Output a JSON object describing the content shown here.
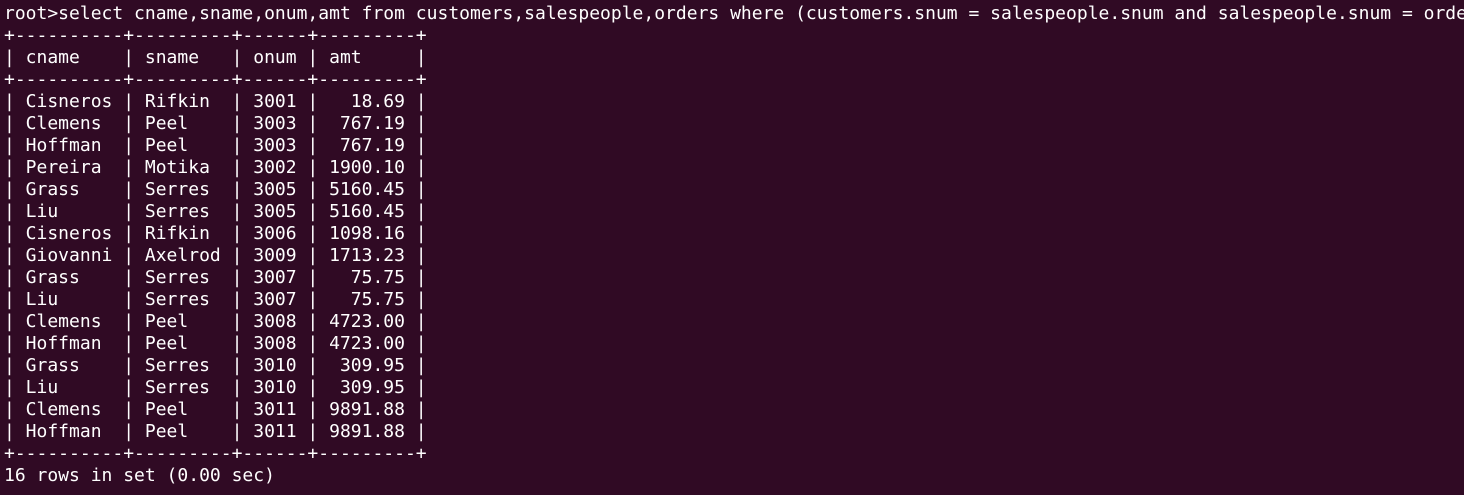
{
  "terminal": {
    "command_line": "root>select cname,sname,onum,amt from customers,salespeople,orders where (customers.snum = salespeople.snum and salespeople.snum = orders.snum);",
    "border_line": "+----------+---------+------+---------+",
    "header_line": "| cname    | sname   | onum | amt     |",
    "rows": [
      "| Cisneros | Rifkin  | 3001 |   18.69 |",
      "| Clemens  | Peel    | 3003 |  767.19 |",
      "| Hoffman  | Peel    | 3003 |  767.19 |",
      "| Pereira  | Motika  | 3002 | 1900.10 |",
      "| Grass    | Serres  | 3005 | 5160.45 |",
      "| Liu      | Serres  | 3005 | 5160.45 |",
      "| Cisneros | Rifkin  | 3006 | 1098.16 |",
      "| Giovanni | Axelrod | 3009 | 1713.23 |",
      "| Grass    | Serres  | 3007 |   75.75 |",
      "| Liu      | Serres  | 3007 |   75.75 |",
      "| Clemens  | Peel    | 3008 | 4723.00 |",
      "| Hoffman  | Peel    | 3008 | 4723.00 |",
      "| Grass    | Serres  | 3010 |  309.95 |",
      "| Liu      | Serres  | 3010 |  309.95 |",
      "| Clemens  | Peel    | 3011 | 9891.88 |",
      "| Hoffman  | Peel    | 3011 | 9891.88 |"
    ],
    "footer_line": "16 rows in set (0.00 sec)",
    "colors": {
      "background": "#300a24",
      "text": "#ffffff"
    }
  }
}
